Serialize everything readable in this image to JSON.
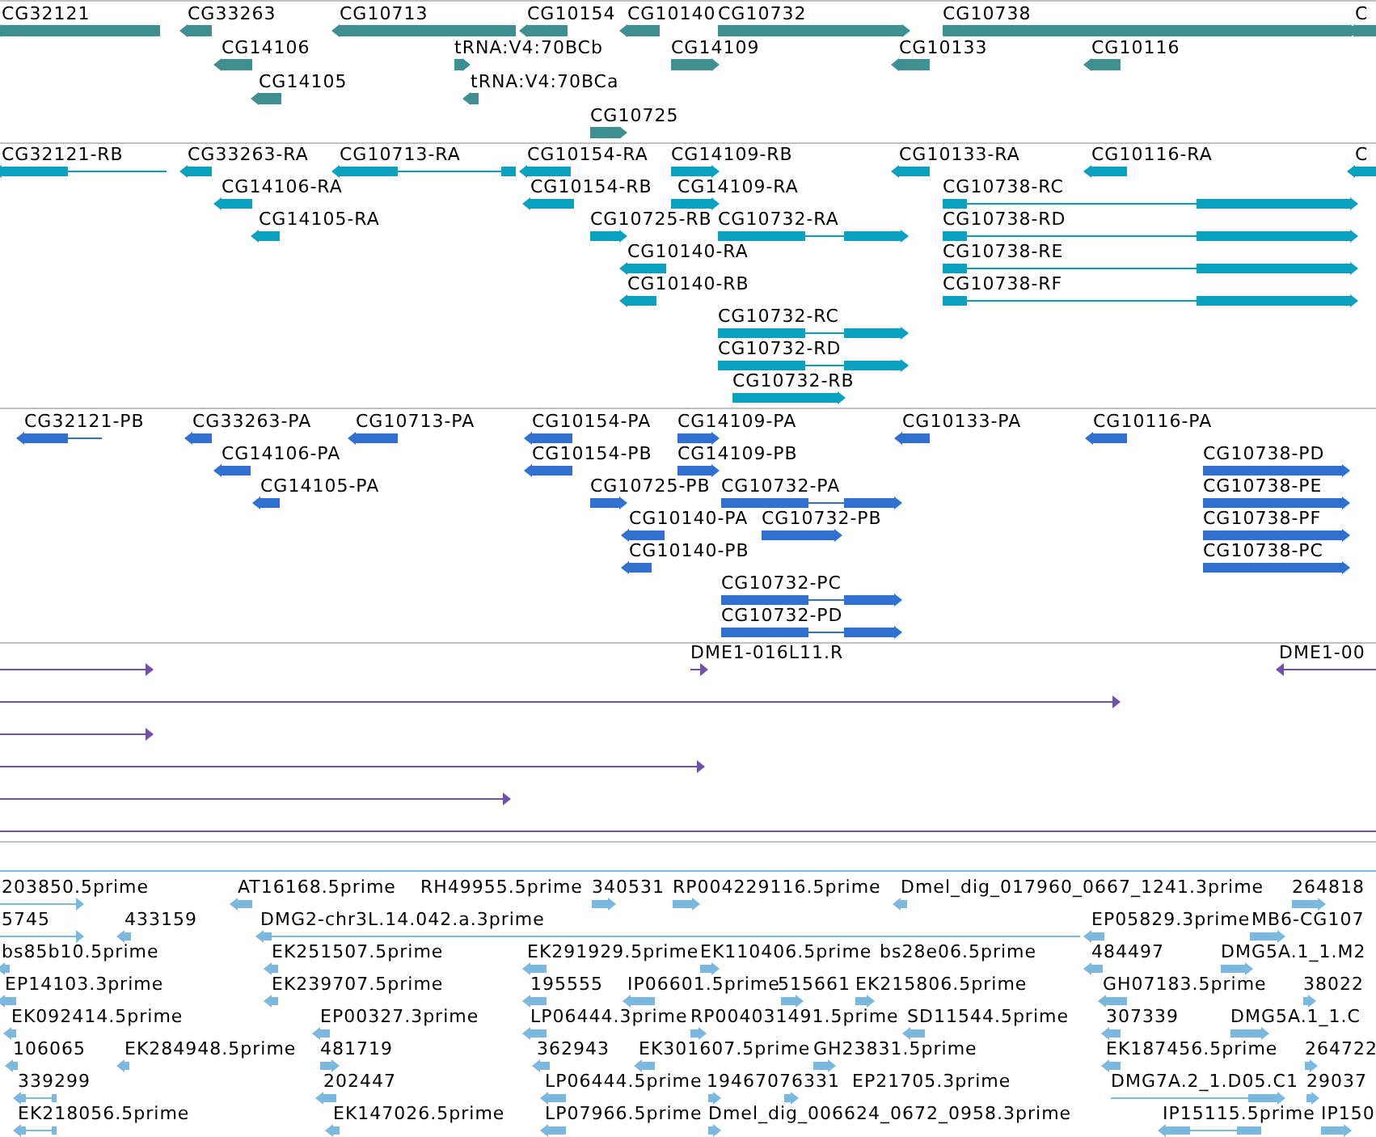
{
  "tracks": [
    {
      "features": [
        {
          "label": "CG32121",
          "reverse": true
        },
        {
          "label": "CG33263",
          "reverse": true
        },
        {
          "label": "CG10713",
          "reverse": true
        },
        {
          "label": "CG10154",
          "reverse": true
        },
        {
          "label": "CG10140",
          "reverse": true
        },
        {
          "label": "CG10732",
          "reverse": false
        },
        {
          "label": "CG10738",
          "reverse": false
        },
        {
          "label": "C",
          "reverse": true
        },
        {
          "label": "CG14106",
          "reverse": true
        },
        {
          "label": "tRNA:V4:70BCb",
          "reverse": false
        },
        {
          "label": "CG14109",
          "reverse": false
        },
        {
          "label": "CG10133",
          "reverse": true
        },
        {
          "label": "CG10116",
          "reverse": true
        },
        {
          "label": "CG14105",
          "reverse": true
        },
        {
          "label": "tRNA:V4:70BCa",
          "reverse": true
        },
        {
          "label": "CG10725",
          "reverse": false
        }
      ]
    },
    {
      "features": [
        {
          "label": "CG32121-RB",
          "reverse": true
        },
        {
          "label": "CG33263-RA",
          "reverse": true
        },
        {
          "label": "CG10713-RA",
          "reverse": true
        },
        {
          "label": "CG10154-RA",
          "reverse": true
        },
        {
          "label": "CG14109-RB",
          "reverse": false
        },
        {
          "label": "CG10133-RA",
          "reverse": true
        },
        {
          "label": "CG10116-RA",
          "reverse": true
        },
        {
          "label": "C",
          "reverse": true
        },
        {
          "label": "CG14106-RA",
          "reverse": true
        },
        {
          "label": "CG10154-RB",
          "reverse": true
        },
        {
          "label": "CG14109-RA",
          "reverse": false
        },
        {
          "label": "CG10738-RC",
          "reverse": false
        },
        {
          "label": "CG14105-RA",
          "reverse": true
        },
        {
          "label": "CG10725-RB",
          "reverse": false
        },
        {
          "label": "CG10732-RA",
          "reverse": false
        },
        {
          "label": "CG10738-RD",
          "reverse": false
        },
        {
          "label": "CG10140-RA",
          "reverse": true
        },
        {
          "label": "CG10738-RE",
          "reverse": false
        },
        {
          "label": "CG10140-RB",
          "reverse": true
        },
        {
          "label": "CG10738-RF",
          "reverse": false
        },
        {
          "label": "CG10732-RC",
          "reverse": false
        },
        {
          "label": "CG10732-RD",
          "reverse": false
        },
        {
          "label": "CG10732-RB",
          "reverse": false
        }
      ]
    },
    {
      "features": [
        {
          "label": "CG32121-PB",
          "reverse": true
        },
        {
          "label": "CG33263-PA",
          "reverse": true
        },
        {
          "label": "CG10713-PA",
          "reverse": true
        },
        {
          "label": "CG10154-PA",
          "reverse": true
        },
        {
          "label": "CG14109-PA",
          "reverse": false
        },
        {
          "label": "CG10133-PA",
          "reverse": true
        },
        {
          "label": "CG10116-PA",
          "reverse": true
        },
        {
          "label": "CG14106-PA",
          "reverse": true
        },
        {
          "label": "CG10154-PB",
          "reverse": true
        },
        {
          "label": "CG14109-PB",
          "reverse": false
        },
        {
          "label": "CG10738-PD",
          "reverse": false
        },
        {
          "label": "CG14105-PA",
          "reverse": true
        },
        {
          "label": "CG10725-PB",
          "reverse": false
        },
        {
          "label": "CG10732-PA",
          "reverse": false
        },
        {
          "label": "CG10738-PE",
          "reverse": false
        },
        {
          "label": "CG10140-PA",
          "reverse": true
        },
        {
          "label": "CG10732-PB",
          "reverse": false
        },
        {
          "label": "CG10738-PF",
          "reverse": false
        },
        {
          "label": "CG10140-PB",
          "reverse": true
        },
        {
          "label": "CG10738-PC",
          "reverse": false
        },
        {
          "label": "CG10732-PC",
          "reverse": false
        },
        {
          "label": "CG10732-PD",
          "reverse": false
        }
      ]
    },
    {
      "features": [
        {
          "reverse": false
        },
        {
          "label": "DME1-016L11.R",
          "reverse": false
        },
        {
          "label": "DME1-00",
          "reverse": true
        },
        {
          "reverse": false
        },
        {
          "reverse": false
        },
        {
          "reverse": false
        },
        {
          "reverse": false
        },
        {
          "kind": "line"
        }
      ]
    },
    {
      "features": [
        {
          "label": "203850.5prime",
          "reverse": false
        },
        {
          "label": "AT16168.5prime",
          "reverse": true
        },
        {
          "label": "RH49955.5prime"
        },
        {
          "label": "340531",
          "reverse": false
        },
        {
          "label": "RP004229116.5prime",
          "reverse": false
        },
        {
          "label": "Dmel_dig_017960_0667_1241.3prime",
          "reverse": true
        },
        {
          "label": "264818",
          "reverse": false
        },
        {
          "label": "5745",
          "reverse": false
        },
        {
          "label": "433159",
          "reverse": true
        },
        {
          "label": "DMG2-chr3L.14.042.a.3prime",
          "reverse": true
        },
        {
          "label": "EP05829.3prime",
          "reverse": true
        },
        {
          "label": "MB6-CG107",
          "reverse": false
        },
        {
          "label": "bs85b10.5prime",
          "reverse": true
        },
        {
          "label": "EK251507.5prime",
          "reverse": true
        },
        {
          "label": "EK291929.5prime",
          "reverse": true
        },
        {
          "label": "EK110406.5prime",
          "reverse": false
        },
        {
          "label": "bs28e06.5prime"
        },
        {
          "label": "484497",
          "reverse": true
        },
        {
          "label": "DMG5A.1_1.M2",
          "reverse": false
        },
        {
          "label": "EP14103.3prime",
          "reverse": true
        },
        {
          "label": "EK239707.5prime",
          "reverse": true
        },
        {
          "label": "195555",
          "reverse": true
        },
        {
          "label": "IP06601.5prime",
          "reverse": true
        },
        {
          "label": "515661",
          "reverse": false
        },
        {
          "label": "EK215806.5prime",
          "reverse": false
        },
        {
          "label": "GH07183.5prime",
          "reverse": true
        },
        {
          "label": "38022",
          "reverse": false
        },
        {
          "label": "EK092414.5prime",
          "reverse": true
        },
        {
          "label": "EP00327.3prime",
          "reverse": true
        },
        {
          "label": "LP06444.3prime",
          "reverse": true
        },
        {
          "label": "RP004031491.5prime",
          "reverse": false
        },
        {
          "label": "SD11544.5prime",
          "reverse": true
        },
        {
          "label": "307339",
          "reverse": true
        },
        {
          "label": "DMG5A.1_1.C",
          "reverse": false
        },
        {
          "label": "106065",
          "reverse": true
        },
        {
          "label": "EK284948.5prime",
          "reverse": true
        },
        {
          "label": "481719",
          "reverse": false
        },
        {
          "label": "362943",
          "reverse": true
        },
        {
          "label": "EK301607.5prime",
          "reverse": true
        },
        {
          "label": "GH23831.5prime",
          "reverse": false
        },
        {
          "label": "EK187456.5prime",
          "reverse": true
        },
        {
          "label": "264722",
          "reverse": false
        },
        {
          "label": "339299",
          "reverse": true
        },
        {
          "label": "202447",
          "reverse": true
        },
        {
          "label": "LP06444.5prime",
          "reverse": true
        },
        {
          "label": "19467076331",
          "reverse": false
        },
        {
          "label": "EP21705.3prime",
          "reverse": false
        },
        {
          "label": "DMG7A.2_1.D05.C1",
          "reverse": false
        },
        {
          "label": "29037",
          "reverse": false
        },
        {
          "label": "EK218056.5prime",
          "reverse": true
        },
        {
          "label": "EK147026.5prime",
          "reverse": true
        },
        {
          "label": "LP07966.5prime",
          "reverse": true
        },
        {
          "label": "Dmel_dig_006624_0672_0958.3prime",
          "reverse": false
        },
        {
          "label": "IP15115.5prime",
          "reverse": true
        },
        {
          "label": "IP150",
          "reverse": false
        }
      ]
    }
  ]
}
